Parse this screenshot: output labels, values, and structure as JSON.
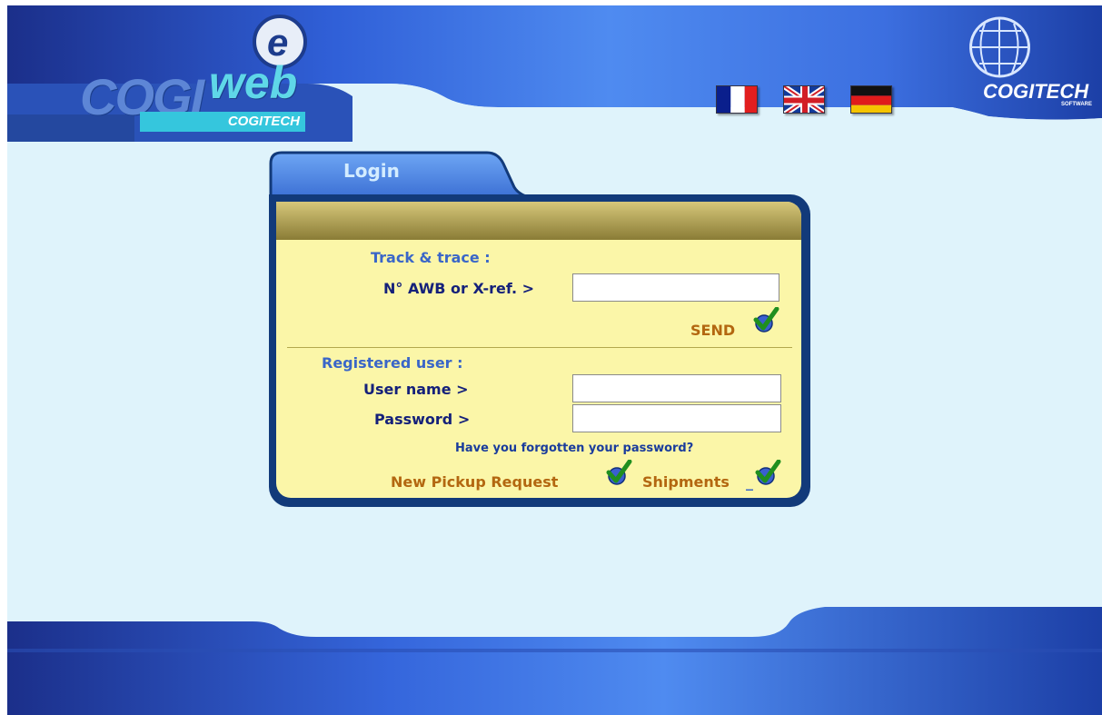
{
  "header": {
    "logo_main": "COGI",
    "logo_web": "web",
    "logo_sub": "COGITECH",
    "brand": "COGITECH",
    "brand_sub": "SOFTWARE"
  },
  "languages": [
    {
      "name": "french-flag-icon"
    },
    {
      "name": "english-flag-icon"
    },
    {
      "name": "german-flag-icon"
    }
  ],
  "login": {
    "tab_label": "Login",
    "track_heading": "Track & trace :",
    "awb_label": "N° AWB or X-ref. >",
    "awb_value": "",
    "send_label": "SEND",
    "registered_heading": "Registered user :",
    "username_label": "User name >",
    "username_value": "",
    "password_label": "Password >",
    "password_value": "",
    "forgot_link": "Have you forgotten your password?",
    "pickup_label": "New Pickup Request",
    "shipments_label": "Shipments",
    "shipments_suffix": "_"
  },
  "colors": {
    "header_blue": "#2f63d2",
    "panel_border": "#123a7a",
    "panel_fill": "#fbf6a8",
    "accent_blue": "#3a66c8",
    "label_navy": "#15217a",
    "action_gold": "#b36710",
    "check_green": "#1f8f1f"
  }
}
